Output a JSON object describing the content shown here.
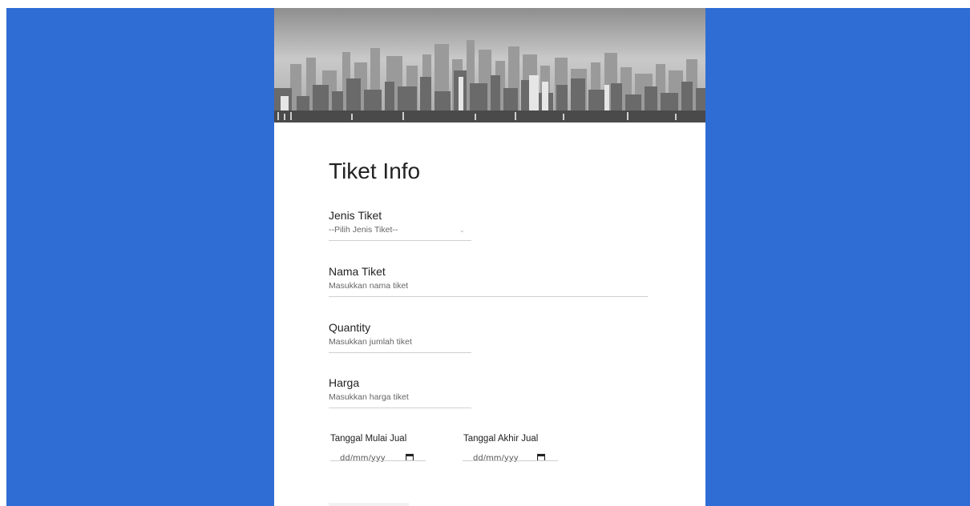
{
  "form": {
    "title": "Tiket Info",
    "fields": {
      "jenis": {
        "label": "Jenis Tiket",
        "value": "--Pilih Jenis Tiket--"
      },
      "nama": {
        "label": "Nama Tiket",
        "placeholder": "Masukkan nama tiket"
      },
      "quantity": {
        "label": "Quantity",
        "placeholder": "Masukkan jumlah tiket"
      },
      "harga": {
        "label": "Harga",
        "placeholder": "Masukkan harga tiket"
      }
    },
    "dates": {
      "mulai": {
        "label": "Tanggal Mulai Jual",
        "placeholder": "dd/mm/yyy"
      },
      "akhir": {
        "label": "Tanggal Akhir Jual",
        "placeholder": "dd/mm/yyy"
      }
    }
  },
  "colors": {
    "background": "#2f6dd5",
    "card": "#ffffff",
    "underline": "#cfcfcf"
  },
  "icons": {
    "select": "chevron-down-icon",
    "date": "calendar-icon"
  }
}
